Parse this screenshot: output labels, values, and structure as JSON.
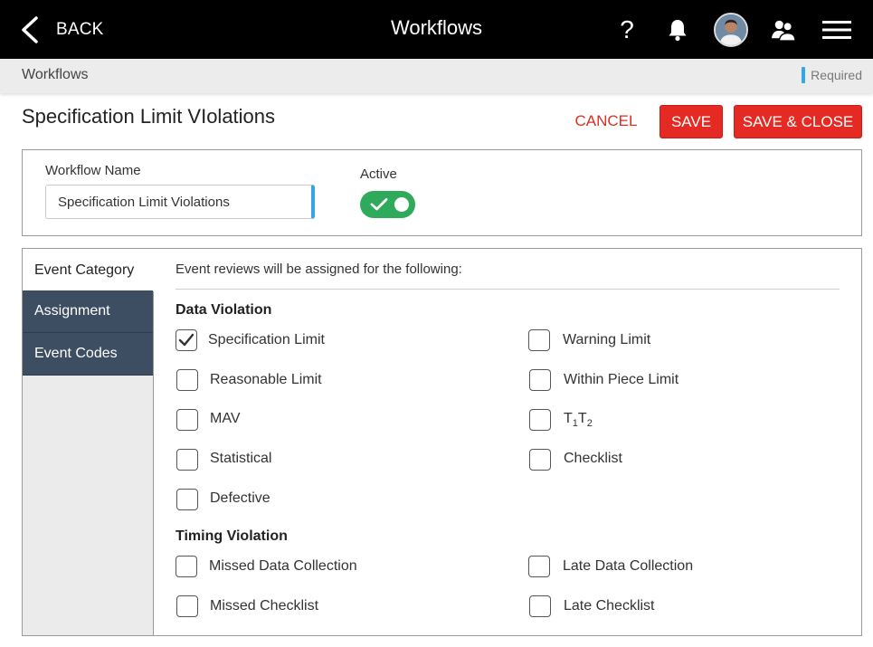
{
  "topbar": {
    "back_label": "BACK",
    "title": "Workflows",
    "help_glyph": "?",
    "icons": [
      "chevron-left-icon",
      "help-icon",
      "bell-icon",
      "avatar",
      "users-icon",
      "hamburger-menu-icon"
    ]
  },
  "breadcrumb": {
    "label": "Workflows",
    "required_label": "Required"
  },
  "header": {
    "title": "Specification Limit VIolations",
    "cancel_label": "CANCEL",
    "save_label": "SAVE",
    "save_close_label": "SAVE & CLOSE"
  },
  "workflow": {
    "name_label": "Workflow Name",
    "name_value": "Specification Limit Violations",
    "active_label": "Active",
    "active": true
  },
  "nav": {
    "items": [
      {
        "label": "Event Category",
        "selected": true
      },
      {
        "label": "Assignment",
        "selected": false
      },
      {
        "label": "Event Codes",
        "selected": false
      }
    ]
  },
  "content": {
    "intro": "Event reviews will be assigned for the following:",
    "data_violation": {
      "title": "Data Violation",
      "items": {
        "specification_limit": {
          "label": "Specification Limit",
          "checked": true
        },
        "warning_limit": {
          "label": "Warning Limit",
          "checked": false
        },
        "reasonable_limit": {
          "label": "Reasonable Limit",
          "checked": false
        },
        "within_piece_limit": {
          "label": "Within Piece Limit",
          "checked": false
        },
        "mav": {
          "label": "MAV",
          "checked": false
        },
        "t1t2": {
          "label_t1": "T",
          "sub1": "1",
          "label_t2": "T",
          "sub2": "2",
          "checked": false
        },
        "statistical": {
          "label": "Statistical",
          "checked": false
        },
        "checklist": {
          "label": "Checklist",
          "checked": false
        },
        "defective": {
          "label": "Defective",
          "checked": false
        }
      }
    },
    "timing_violation": {
      "title": "Timing Violation",
      "items": {
        "missed_data_collection": {
          "label": "Missed Data Collection",
          "checked": false
        },
        "late_data_collection": {
          "label": "Late Data Collection",
          "checked": false
        },
        "missed_checklist": {
          "label": "Missed Checklist",
          "checked": false
        },
        "late_checklist": {
          "label": "Late Checklist",
          "checked": false
        }
      }
    }
  },
  "colors": {
    "topbar_bg": "#000000",
    "accent_red": "#e42a22",
    "toggle_green": "#2eaa5a",
    "nav_dark": "#3d4e62",
    "required_blue": "#35a7e0"
  }
}
